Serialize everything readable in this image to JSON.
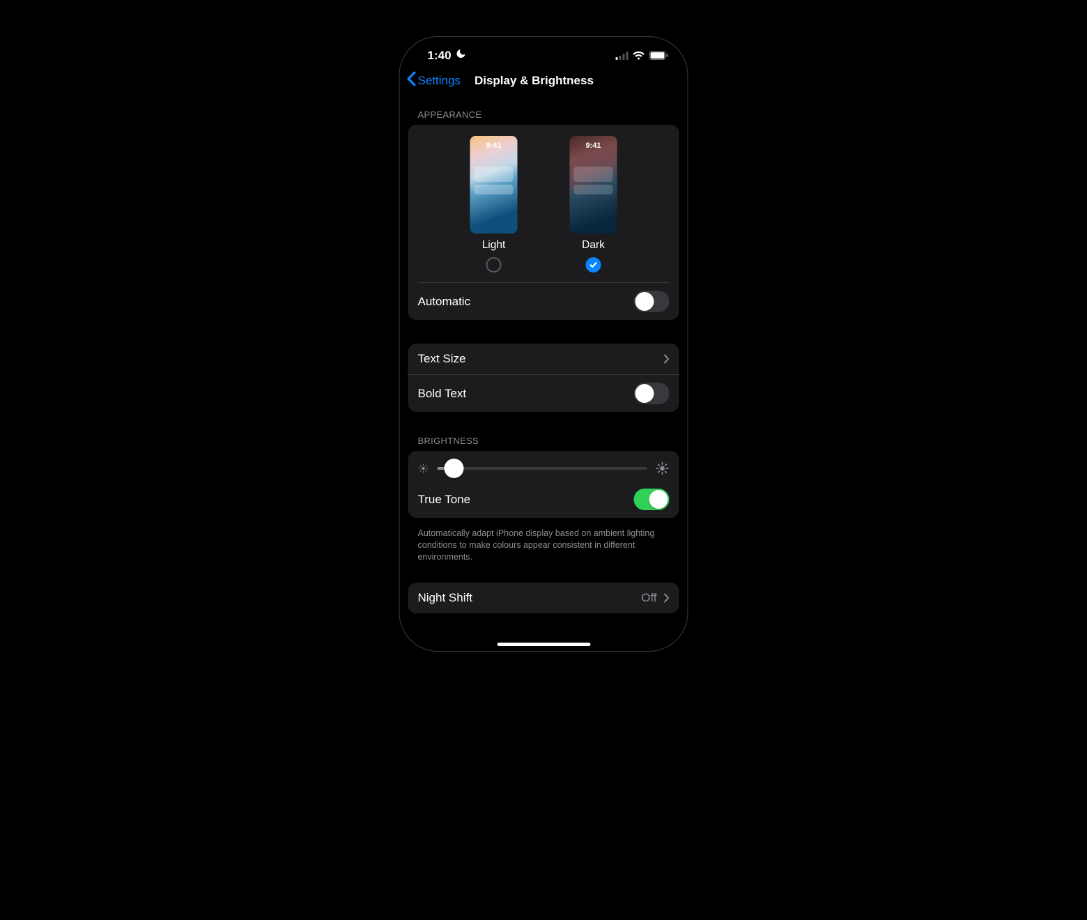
{
  "status": {
    "time": "1:40",
    "dnd": true
  },
  "nav": {
    "back_label": "Settings",
    "title": "Display & Brightness"
  },
  "appearance": {
    "header": "APPEARANCE",
    "preview_time": "9:41",
    "options": {
      "light": {
        "label": "Light",
        "selected": false
      },
      "dark": {
        "label": "Dark",
        "selected": true
      }
    },
    "automatic": {
      "label": "Automatic",
      "on": false
    }
  },
  "text": {
    "text_size_label": "Text Size",
    "bold_text_label": "Bold Text",
    "bold_text_on": false
  },
  "brightness": {
    "header": "BRIGHTNESS",
    "value_percent": 8,
    "true_tone_label": "True Tone",
    "true_tone_on": true,
    "footer": "Automatically adapt iPhone display based on ambient lighting conditions to make colours appear consistent in different environments."
  },
  "night_shift": {
    "label": "Night Shift",
    "value": "Off"
  },
  "colors": {
    "accent": "#0a84ff",
    "switch_on": "#30d158"
  }
}
